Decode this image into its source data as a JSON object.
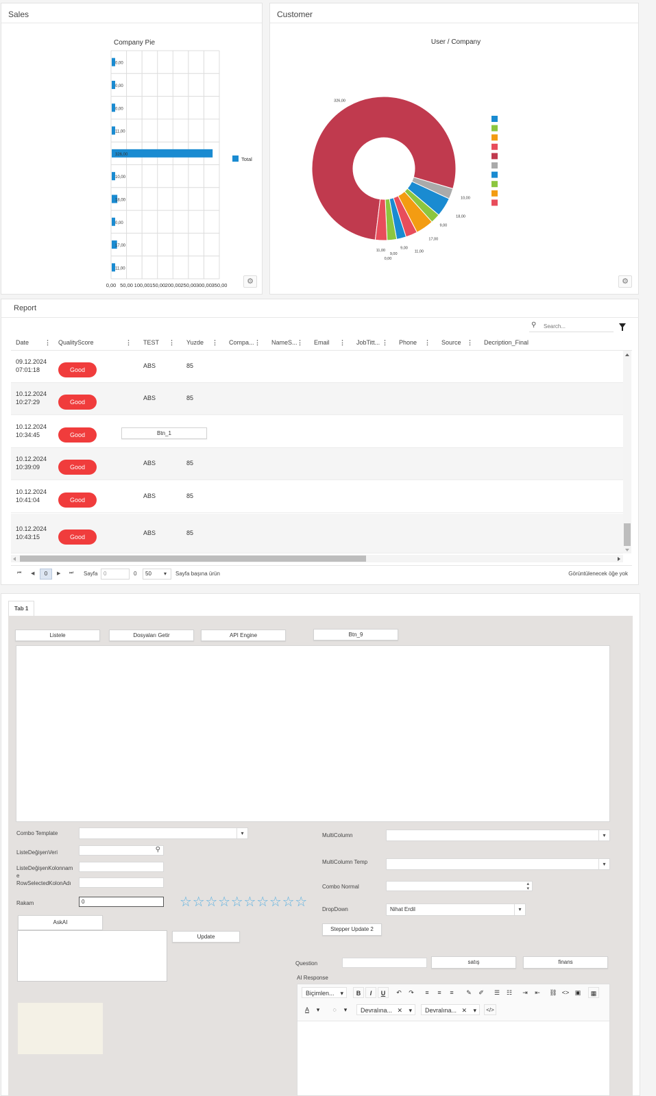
{
  "sales": {
    "title": "Sales",
    "chart_title": "Company Pie"
  },
  "customer": {
    "title": "Customer",
    "chart_title": "User / Company"
  },
  "chart_data": [
    {
      "type": "bar",
      "title": "Company Pie",
      "orientation": "horizontal",
      "values": [
        0,
        0,
        0,
        11,
        326,
        10,
        18,
        0,
        17,
        11
      ],
      "value_labels": [
        "0,00",
        "0,00",
        "0,00",
        "11,00",
        "326,00",
        "10,00",
        "18,00",
        "0,00",
        "17,00",
        "11,00"
      ],
      "x_ticks": [
        "0,00",
        "50,00",
        "100,00",
        "150,00",
        "200,00",
        "250,00",
        "300,00",
        "350,00"
      ],
      "xlim": [
        0,
        350
      ],
      "series": [
        {
          "name": "Total"
        }
      ],
      "legend_position": "right",
      "color": "#1a8bd1"
    },
    {
      "type": "pie",
      "variant": "donut",
      "title": "User / Company",
      "values": [
        326,
        10,
        18,
        9,
        17,
        11,
        9,
        9,
        0,
        11
      ],
      "labels": [
        "326,00",
        "10,00",
        "18,00",
        "9,00",
        "17,00",
        "11,00",
        "9,00",
        "9,00",
        "0,00",
        "11,00"
      ],
      "colors": [
        "#c03a4e",
        "#aaaaaa",
        "#1a8bd1",
        "#8cc63f",
        "#f39c12",
        "#e84d5b",
        "#1a8bd1",
        "#8cc63f",
        "#f39c12",
        "#e84d5b"
      ],
      "legend_colors": [
        "#1a8bd1",
        "#8cc63f",
        "#f39c12",
        "#e84d5b",
        "#c03a4e",
        "#aaaaaa",
        "#1a8bd1",
        "#8cc63f",
        "#f39c12",
        "#e84d5b"
      ],
      "legend_position": "right"
    }
  ],
  "report": {
    "title": "Report",
    "search_placeholder": "Search...",
    "columns": [
      "Date",
      "QualityScore",
      "TEST",
      "Yuzde",
      "Compa...",
      "NameS...",
      "Email",
      "JobTitt...",
      "Phone",
      "Source",
      "Decription_Final"
    ],
    "rows": [
      {
        "date": "09.12.2024",
        "time": "07:01:18",
        "quality": "Good",
        "test": "ABS",
        "yuzde": "85"
      },
      {
        "date": "10.12.2024",
        "time": "10:27:29",
        "quality": "Good",
        "test": "ABS",
        "yuzde": "85"
      },
      {
        "date": "10.12.2024",
        "time": "10:34:45",
        "quality": "Good",
        "button": "Btn_1"
      },
      {
        "date": "10.12.2024",
        "time": "10:39:09",
        "quality": "Good",
        "test": "ABS",
        "yuzde": "85"
      },
      {
        "date": "10.12.2024",
        "time": "10:41:04",
        "quality": "Good",
        "test": "ABS",
        "yuzde": "85"
      },
      {
        "date": "10.12.2024",
        "time": "10:43:15",
        "quality": "Good",
        "test": "ABS",
        "yuzde": "85"
      }
    ],
    "pager": {
      "current_page": "0",
      "page_label": "Sayfa",
      "page_input": "0",
      "page_count": "0",
      "page_size": "50",
      "per_page_label": "Sayfa başına ürün",
      "status": "Görüntülenecek öğe yok"
    }
  },
  "tab": {
    "label": "Tab 1",
    "buttons": [
      "Listele",
      "Dosyaları Getir",
      "API Engine",
      "Btn_9"
    ],
    "combo_template_label": "Combo Template",
    "liste_label": "ListeDeğişenVeri",
    "liste_kolon_label": "ListeDeğişenKolonnam",
    "liste_kolon_label_wrap": "e",
    "row_selected_label": "RowSelectedKolonAdı",
    "rakam_label": "Rakam",
    "rakam_value": "0",
    "askai_button": "AskAI",
    "update_button": "Update",
    "multicolumn_label": "MultiColumn",
    "multicolumn_temp_label": "MultiColumn Temp",
    "combo_normal_label": "Combo Normal",
    "dropdown_label": "DropDown",
    "dropdown_value": "Nihat Erdil",
    "stepper_button": "Stepper Update 2",
    "question_label": "Question",
    "satis_button": "satış",
    "finans_button": "finans",
    "ai_response_label": "AI Response",
    "editor_format": "Biçimlen...",
    "editor_font1": "Devralına...",
    "editor_font2": "Devralına...",
    "rating_stars": 10,
    "rating_value": 0
  }
}
